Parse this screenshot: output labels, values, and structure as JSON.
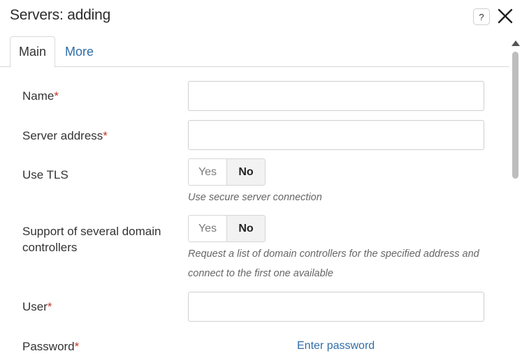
{
  "window": {
    "title": "Servers: adding",
    "help_label": "?",
    "close_label": "close"
  },
  "tabs": [
    {
      "label": "Main",
      "active": true
    },
    {
      "label": "More",
      "active": false
    }
  ],
  "form": {
    "required_mark": "*",
    "name": {
      "label": "Name",
      "value": ""
    },
    "server_address": {
      "label": "Server address",
      "value": ""
    },
    "use_tls": {
      "label": "Use TLS",
      "yes": "Yes",
      "no": "No",
      "selected": "No",
      "hint": "Use secure server connection"
    },
    "several_controllers": {
      "label_line1": "Support of several domain",
      "label_line2": "controllers",
      "yes": "Yes",
      "no": "No",
      "selected": "No",
      "hint": "Request a list of domain controllers for the specified address and connect to the first one available"
    },
    "user": {
      "label": "User",
      "value": ""
    },
    "password": {
      "label": "Password",
      "link": "Enter password"
    }
  },
  "colors": {
    "link": "#2f6da8",
    "required": "#c0392b",
    "border": "#cfcfcf"
  }
}
